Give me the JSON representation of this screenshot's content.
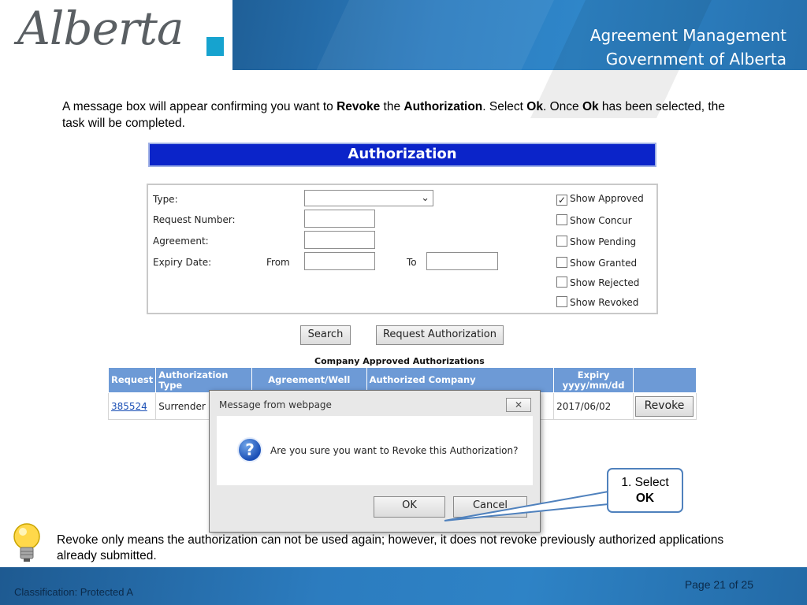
{
  "header": {
    "logo_text": "Alberta",
    "title_line1": "Agreement Management",
    "title_line2": "Government of Alberta"
  },
  "instruction": {
    "part1": "A message box will appear confirming you want to ",
    "revoke": "Revoke",
    "part2": " the ",
    "authorization": "Authorization",
    "part3": ".  Select ",
    "ok1": "Ok",
    "part4": ".  Once ",
    "ok2": "Ok",
    "part5": " has been selected, the task will be completed."
  },
  "form": {
    "banner": "Authorization",
    "labels": {
      "type": "Type:",
      "request_number": "Request Number:",
      "agreement": "Agreement:",
      "expiry_date": "Expiry Date:",
      "from": "From",
      "to": "To"
    },
    "checkboxes": [
      {
        "label": "Show Approved",
        "checked": true
      },
      {
        "label": "Show Concur",
        "checked": false
      },
      {
        "label": "Show Pending",
        "checked": false
      },
      {
        "label": "Show Granted",
        "checked": false
      },
      {
        "label": "Show Rejected",
        "checked": false
      },
      {
        "label": "Show Revoked",
        "checked": false
      }
    ],
    "search_button": "Search",
    "request_button": "Request Authorization"
  },
  "table": {
    "caption": "Company Approved Authorizations",
    "headers": [
      "Request",
      "Authorization Type",
      "Agreement/Well",
      "Authorized Company",
      "Expiry yyyy/mm/dd",
      ""
    ],
    "row": {
      "request": "385524",
      "type": "Surrender",
      "expiry": "2017/06/02",
      "action": "Revoke"
    }
  },
  "dialog": {
    "title": "Message from webpage",
    "message": "Are you sure you want to Revoke this Authorization?",
    "ok": "OK",
    "cancel": "Cancel"
  },
  "callout": {
    "line1": "1. Select",
    "line2": "OK"
  },
  "tip": "Revoke only means the authorization can not be used again; however, it does not revoke previously authorized applications already submitted.",
  "footer": {
    "classification": "Classification: Protected A",
    "page": "Page 21 of 25"
  },
  "colors": {
    "header_blue": "#2c7cbf",
    "banner_blue": "#0b24c9",
    "table_header": "#6d9ad6",
    "logo_accent": "#16a3cf"
  }
}
